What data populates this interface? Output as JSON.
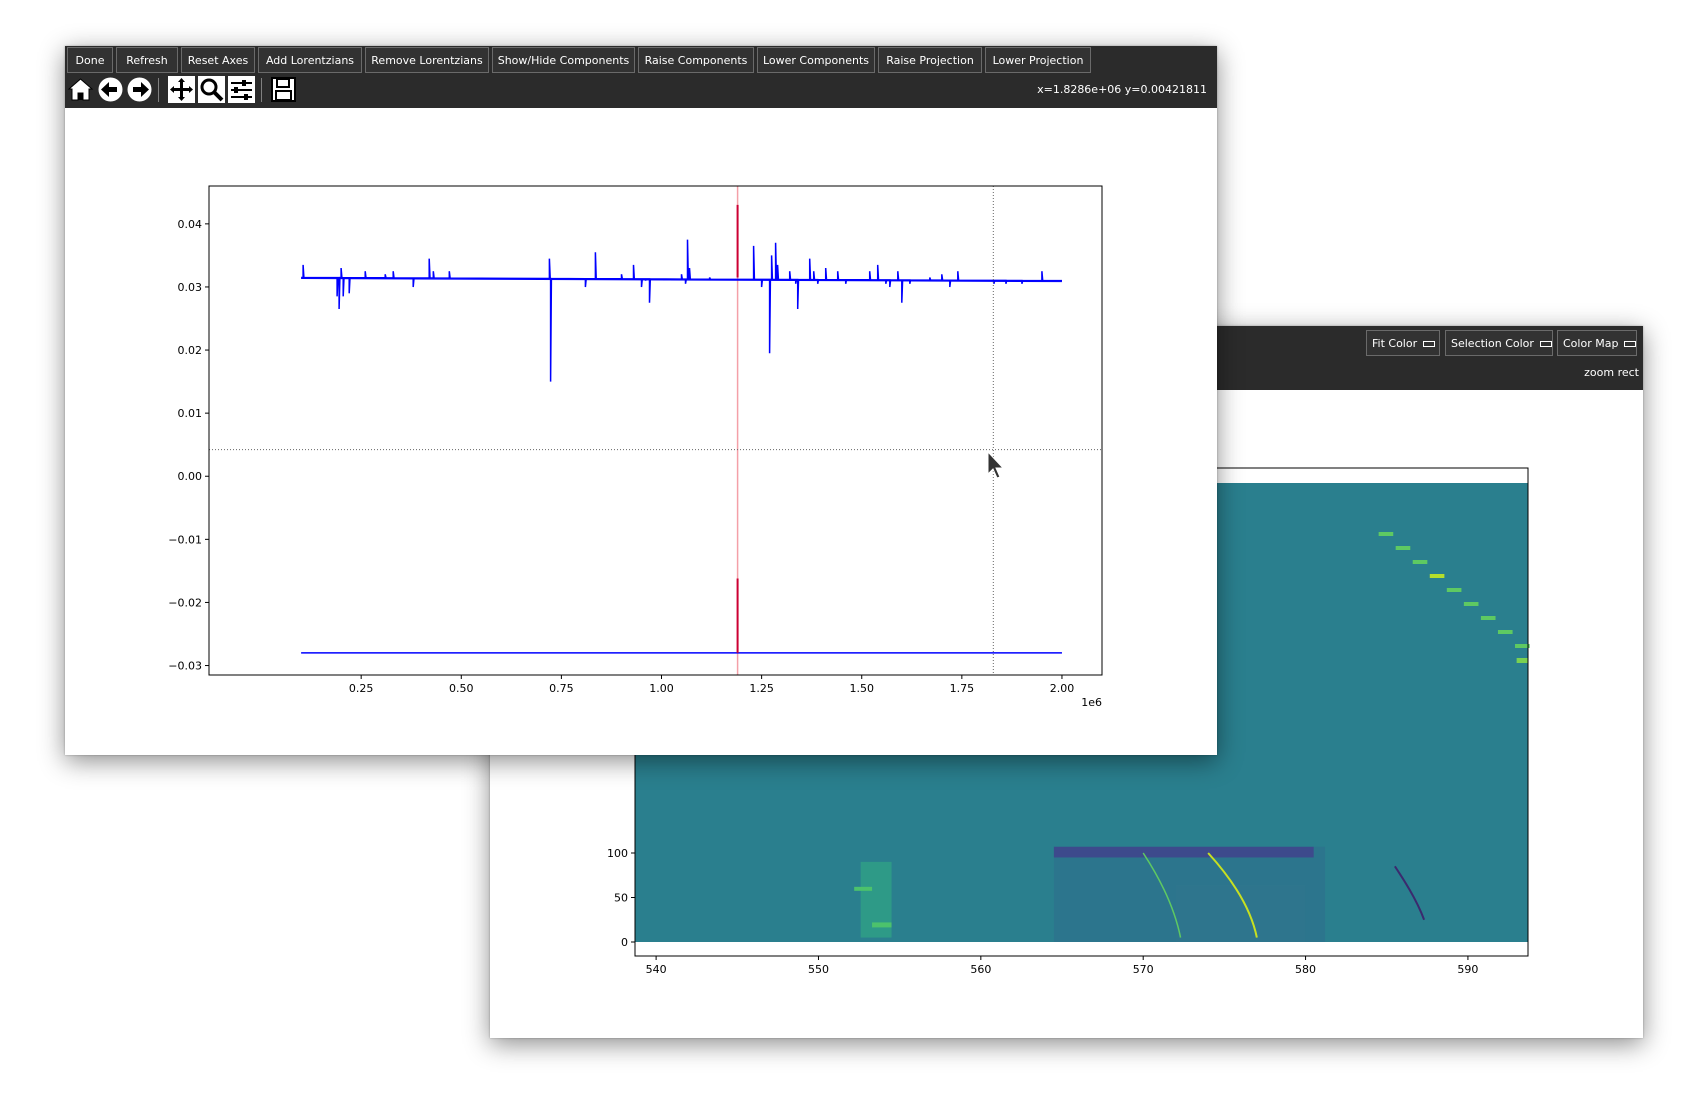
{
  "front_window": {
    "buttons": [
      "Done",
      "Refresh",
      "Reset Axes",
      "Add Lorentzians",
      "Remove Lorentzians",
      "Show/Hide Components",
      "Raise Components",
      "Lower Components",
      "Raise Projection",
      "Lower Projection"
    ],
    "toolbar_icons": [
      "home-icon",
      "back-arrow-icon",
      "forward-arrow-icon",
      "pan-icon",
      "zoom-icon",
      "subplots-icon",
      "save-icon"
    ],
    "coords_readout": "x=1.8286e+06   y=0.00421811",
    "cursor_crosshair": {
      "x": 1828600,
      "y": 0.00421811
    }
  },
  "back_window": {
    "dropdowns": [
      "Fit Color",
      "Selection Color",
      "Color Map"
    ],
    "mode_text": "zoom rect"
  },
  "chart_data": [
    {
      "type": "line",
      "x_offset_label": "1e6",
      "xlim": [
        -0.13,
        2.1
      ],
      "ylim": [
        -0.0315,
        0.046
      ],
      "x_ticks": [
        0.25,
        0.5,
        0.75,
        1.0,
        1.25,
        1.5,
        1.75,
        2.0
      ],
      "x_tick_labels": [
        "0.25",
        "0.50",
        "0.75",
        "1.00",
        "1.25",
        "1.50",
        "1.75",
        "2.00"
      ],
      "y_ticks": [
        0.04,
        0.03,
        0.02,
        0.01,
        0.0,
        -0.01,
        -0.02,
        -0.03
      ],
      "y_tick_labels": [
        "0.04",
        "0.03",
        "0.02",
        "0.01",
        "0.00",
        "−0.01",
        "−0.02",
        "−0.03"
      ],
      "grid": false,
      "series": [
        {
          "color": "#0000ff",
          "baseline": {
            "x_start": 0.1,
            "x_end": 2.0,
            "y_start": 0.0315,
            "y_end": 0.031
          },
          "spikes": [
            {
              "x": 0.105,
              "y": 0.0335
            },
            {
              "x": 0.19,
              "y": 0.0285
            },
            {
              "x": 0.195,
              "y": 0.0265
            },
            {
              "x": 0.2,
              "y": 0.033
            },
            {
              "x": 0.205,
              "y": 0.0285
            },
            {
              "x": 0.22,
              "y": 0.029
            },
            {
              "x": 0.26,
              "y": 0.0325
            },
            {
              "x": 0.31,
              "y": 0.032
            },
            {
              "x": 0.33,
              "y": 0.0325
            },
            {
              "x": 0.38,
              "y": 0.03
            },
            {
              "x": 0.42,
              "y": 0.0345
            },
            {
              "x": 0.43,
              "y": 0.0325
            },
            {
              "x": 0.47,
              "y": 0.0325
            },
            {
              "x": 0.72,
              "y": 0.0345
            },
            {
              "x": 0.723,
              "y": 0.015
            },
            {
              "x": 0.81,
              "y": 0.03
            },
            {
              "x": 0.835,
              "y": 0.0355
            },
            {
              "x": 0.9,
              "y": 0.032
            },
            {
              "x": 0.93,
              "y": 0.0335
            },
            {
              "x": 0.95,
              "y": 0.03
            },
            {
              "x": 0.96,
              "y": 0.031
            },
            {
              "x": 0.97,
              "y": 0.0275
            },
            {
              "x": 1.05,
              "y": 0.032
            },
            {
              "x": 1.06,
              "y": 0.0305
            },
            {
              "x": 1.065,
              "y": 0.0375
            },
            {
              "x": 1.07,
              "y": 0.033
            },
            {
              "x": 1.12,
              "y": 0.0315
            },
            {
              "x": 1.23,
              "y": 0.0365
            },
            {
              "x": 1.25,
              "y": 0.03
            },
            {
              "x": 1.27,
              "y": 0.0195
            },
            {
              "x": 1.275,
              "y": 0.035
            },
            {
              "x": 1.285,
              "y": 0.037
            },
            {
              "x": 1.29,
              "y": 0.0335
            },
            {
              "x": 1.32,
              "y": 0.0325
            },
            {
              "x": 1.335,
              "y": 0.0305
            },
            {
              "x": 1.34,
              "y": 0.0265
            },
            {
              "x": 1.37,
              "y": 0.0345
            },
            {
              "x": 1.38,
              "y": 0.0325
            },
            {
              "x": 1.39,
              "y": 0.0305
            },
            {
              "x": 1.41,
              "y": 0.033
            },
            {
              "x": 1.44,
              "y": 0.0325
            },
            {
              "x": 1.46,
              "y": 0.0305
            },
            {
              "x": 1.52,
              "y": 0.0325
            },
            {
              "x": 1.54,
              "y": 0.0335
            },
            {
              "x": 1.56,
              "y": 0.0305
            },
            {
              "x": 1.57,
              "y": 0.03
            },
            {
              "x": 1.59,
              "y": 0.0325
            },
            {
              "x": 1.6,
              "y": 0.0275
            },
            {
              "x": 1.62,
              "y": 0.0305
            },
            {
              "x": 1.67,
              "y": 0.0315
            },
            {
              "x": 1.7,
              "y": 0.032
            },
            {
              "x": 1.72,
              "y": 0.03
            },
            {
              "x": 1.74,
              "y": 0.0325
            },
            {
              "x": 1.83,
              "y": 0.0305
            },
            {
              "x": 1.86,
              "y": 0.0305
            },
            {
              "x": 1.9,
              "y": 0.0305
            },
            {
              "x": 1.95,
              "y": 0.0325
            }
          ]
        },
        {
          "color": "#0000ff",
          "baseline": {
            "x_start": 0.1,
            "x_end": 2.0,
            "y_start": -0.028,
            "y_end": -0.028
          }
        },
        {
          "color": "#cc0033",
          "projection_x": 1.19,
          "top_spike": {
            "y0": 0.0315,
            "y1": 0.043
          },
          "bottom_spike": {
            "y0": -0.028,
            "y1": -0.0162
          }
        }
      ]
    },
    {
      "type": "heatmap",
      "colormap": "viridis",
      "x_ticks": [
        540,
        550,
        560,
        570,
        580,
        590
      ],
      "x_tick_labels": [
        "540",
        "550",
        "560",
        "570",
        "580",
        "590"
      ],
      "y_ticks": [
        0,
        50,
        100
      ],
      "y_tick_labels": [
        "0",
        "50",
        "100"
      ],
      "xlim": [
        538.7,
        593.7
      ],
      "visible_ylim": [
        -7,
        100
      ]
    }
  ]
}
